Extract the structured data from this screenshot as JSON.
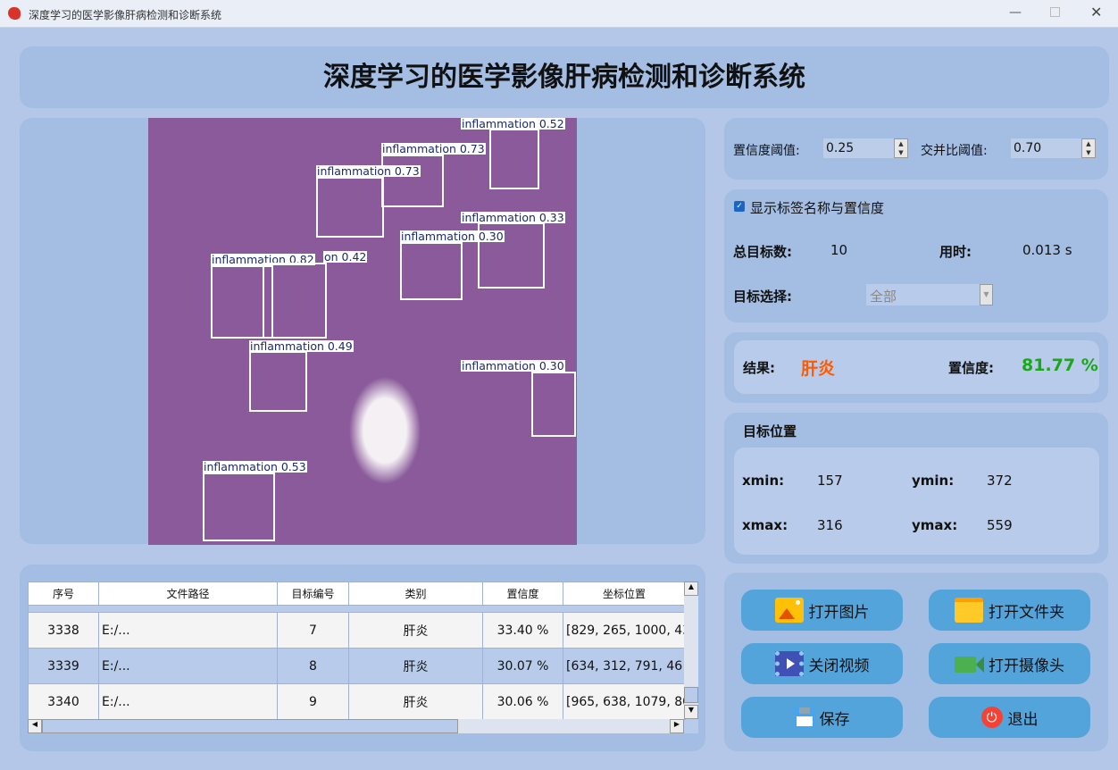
{
  "window": {
    "title": "深度学习的医学影像肝病检测和诊断系统"
  },
  "header": {
    "title": "深度学习的医学影像肝病检测和诊断系统"
  },
  "detections": [
    {
      "label": "inflammation 0.52"
    },
    {
      "label": "inflammation 0.73"
    },
    {
      "label": "inflammation 0.73"
    },
    {
      "label": "inflammation 0.33"
    },
    {
      "label": "inflammation 0.30"
    },
    {
      "label": "inflammation 0.82"
    },
    {
      "label": "on 0.42"
    },
    {
      "label": "inflammation 0.49"
    },
    {
      "label": "inflammation 0.30"
    },
    {
      "label": "inflammation 0.53"
    }
  ],
  "settings": {
    "conf_label": "置信度阈值:",
    "conf_value": "0.25",
    "iou_label": "交并比阈值:",
    "iou_value": "0.70"
  },
  "stats": {
    "show_labels": "显示标签名称与置信度",
    "show_labels_checked": true,
    "total_label": "总目标数:",
    "total_value": "10",
    "time_label": "用时:",
    "time_value": "0.013 s",
    "select_label": "目标选择:",
    "select_value": "全部"
  },
  "result": {
    "label": "结果:",
    "value": "肝炎",
    "conf_label": "置信度:",
    "conf_value": "81.77 %",
    "value_color": "#ff5a00",
    "conf_color": "#18a818"
  },
  "position": {
    "title": "目标位置",
    "xmin_label": "xmin:",
    "xmin": "157",
    "ymin_label": "ymin:",
    "ymin": "372",
    "xmax_label": "xmax:",
    "xmax": "316",
    "ymax_label": "ymax:",
    "ymax": "559"
  },
  "table": {
    "headers": [
      "序号",
      "文件路径",
      "目标编号",
      "类别",
      "置信度",
      "坐标位置"
    ],
    "rows": [
      [
        "3338",
        "E:/...",
        "7",
        "肝炎",
        "33.40 %",
        "[829, 265, 1000, 43"
      ],
      [
        "3339",
        "E:/...",
        "8",
        "肝炎",
        "30.07 %",
        "[634, 312, 791, 46"
      ],
      [
        "3340",
        "E:/...",
        "9",
        "肝炎",
        "30.06 %",
        "[965, 638, 1079, 80"
      ]
    ]
  },
  "buttons": {
    "open_image": "打开图片",
    "open_folder": "打开文件夹",
    "close_video": "关闭视频",
    "open_camera": "打开摄像头",
    "save": "保存",
    "exit": "退出"
  }
}
